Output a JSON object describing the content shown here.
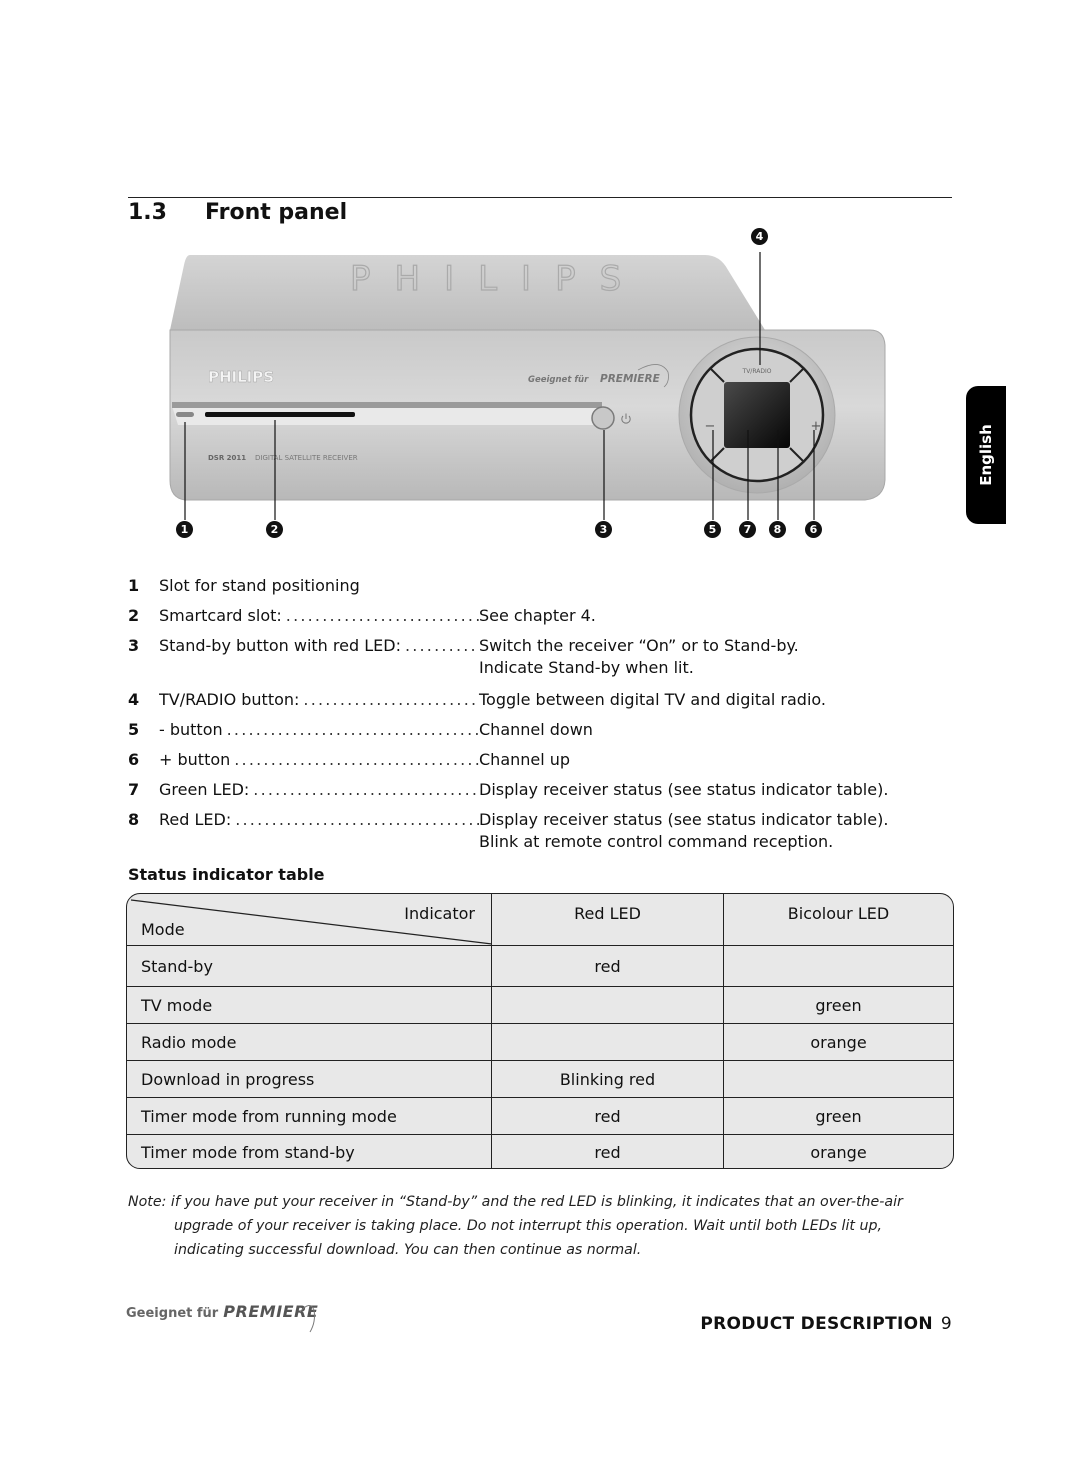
{
  "section": {
    "number": "1.3",
    "title": "Front panel"
  },
  "device": {
    "top_brand": "PHILIPS",
    "front_brand": "PHILIPS",
    "certification": "Geeignet für",
    "certification_brand": "PREMIERE",
    "model": "DSR 2011",
    "model_desc": "DIGITAL SATELLITE RECEIVER",
    "tv_radio_label": "TV/RADIO",
    "minus_symbol": "−",
    "plus_symbol": "+",
    "power_icon": "power-icon",
    "callouts": [
      "1",
      "2",
      "3",
      "4",
      "5",
      "7",
      "8",
      "6"
    ]
  },
  "language_tab": "English",
  "features": [
    {
      "num": "1",
      "label": "Slot for stand positioning",
      "leader": false,
      "desc": []
    },
    {
      "num": "2",
      "label": "Smartcard slot: ",
      "leader": true,
      "desc": [
        "See chapter 4."
      ]
    },
    {
      "num": "3",
      "label": "Stand-by button with red LED: ",
      "leader": true,
      "desc": [
        "Switch the receiver “On” or to Stand-by.",
        "Indicate Stand-by when lit."
      ]
    },
    {
      "num": "4",
      "label": "TV/RADIO button: ",
      "leader": true,
      "desc": [
        "Toggle between digital TV and digital radio."
      ]
    },
    {
      "num": "5",
      "label": "- button ",
      "leader": true,
      "desc": [
        "Channel down"
      ]
    },
    {
      "num": "6",
      "label": "+ button ",
      "leader": true,
      "desc": [
        "Channel up"
      ]
    },
    {
      "num": "7",
      "label": "Green LED: ",
      "leader": true,
      "desc": [
        "Display receiver status (see status indicator table)."
      ]
    },
    {
      "num": "8",
      "label": "Red LED: ",
      "leader": true,
      "desc": [
        "Display receiver status (see status indicator table).",
        "Blink at remote control command reception."
      ]
    }
  ],
  "status_table": {
    "title": "Status indicator table",
    "header": {
      "indicator": "Indicator",
      "mode": "Mode",
      "red_led": "Red LED",
      "bicolour_led": "Bicolour LED"
    },
    "rows": [
      {
        "mode": "Stand-by",
        "red_led": "red",
        "bicolour_led": ""
      },
      {
        "mode": "TV mode",
        "red_led": "",
        "bicolour_led": "green"
      },
      {
        "mode": "Radio mode",
        "red_led": "",
        "bicolour_led": "orange"
      },
      {
        "mode": "Download in progress",
        "red_led": "Blinking red",
        "bicolour_led": ""
      },
      {
        "mode": "Timer mode from running mode",
        "red_led": "red",
        "bicolour_led": "green"
      },
      {
        "mode": "Timer mode from stand-by",
        "red_led": "red",
        "bicolour_led": "orange"
      }
    ]
  },
  "note": {
    "line1": "Note: if you have put your receiver in “Stand-by” and the red LED is blinking, it indicates that an over-the-air",
    "line2": "upgrade of your receiver is taking place. Do not interrupt this operation. Wait until both LEDs lit up,",
    "line3": "indicating successful download. You can then continue as normal."
  },
  "footer": {
    "logo_prefix": "Geeignet für",
    "logo_brand": "PREMIERE",
    "section_label": "PRODUCT DESCRIPTION",
    "page_number": "9"
  }
}
